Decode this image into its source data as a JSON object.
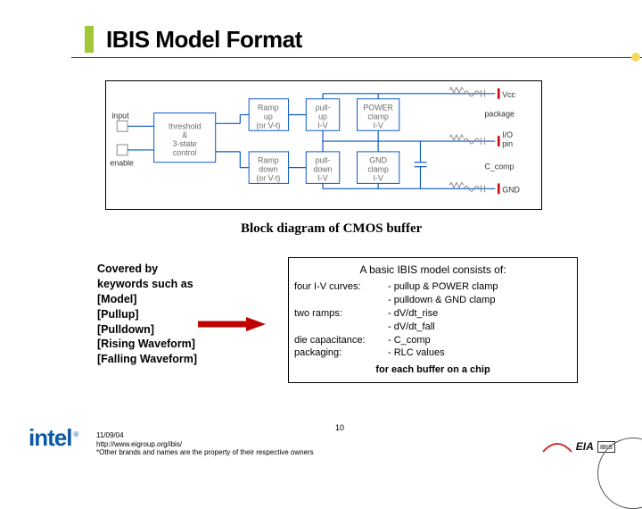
{
  "title": "IBIS Model Format",
  "diagram": {
    "input": "input",
    "enable": "enable",
    "threshold": "threshold & 3-state control",
    "rampup": "Ramp up (or V-t)",
    "rampdown": "Ramp down (or V-t)",
    "pullup": "pull-up I-V",
    "pulldown": "pull-down I-V",
    "powerclamp": "POWER clamp I-V",
    "gndclamp": "GND clamp I-V",
    "package": "package",
    "iopin": "I/O pin",
    "ccomp": "C_comp",
    "vcc": "Vcc",
    "gnd": "GND",
    "caption": "Block diagram of CMOS buffer"
  },
  "left": {
    "l1": "Covered by",
    "l2": "keywords such as",
    "l3": "[Model]",
    "l4": "[Pullup]",
    "l5": "[Pulldown]",
    "l6": "[Rising Waveform]",
    "l7": "[Falling Waveform]"
  },
  "box": {
    "title": "A basic IBIS model consists of:",
    "r1l": "four I-V curves:",
    "r1v1": "- pullup & POWER clamp",
    "r1v2": "- pulldown & GND clamp",
    "r2l": "two ramps:",
    "r2v1": "- dV/dt_rise",
    "r2v2": "- dV/dt_fall",
    "r3l": "die capacitance:",
    "r3v": "- C_comp",
    "r4l": "packaging:",
    "r4v": "- RLC values",
    "footer": "for each buffer on a chip"
  },
  "footer": {
    "date": "11/09/04",
    "url": "http://www.eigroup.org/ibis/",
    "disclaimer": "*Other brands and names are the property of their respective owners",
    "slidenum": "10",
    "intel": "intel",
    "eia": "EIA",
    "ibis": "IBIS"
  },
  "chart_data": {
    "type": "diagram",
    "title": "Block diagram of CMOS buffer",
    "inputs": [
      "input",
      "enable"
    ],
    "control_block": "threshold & 3-state control",
    "driver_blocks": [
      "Ramp up (or V-t)",
      "Ramp down (or V-t)"
    ],
    "iv_blocks": [
      "pull-up I-V",
      "pull-down I-V",
      "POWER clamp I-V",
      "GND clamp I-V"
    ],
    "rails": [
      "Vcc",
      "GND"
    ],
    "package": "package (RLC)",
    "die_cap": "C_comp",
    "output": "I/O pin",
    "ibis_model_contents": {
      "iv_curves": [
        "pullup",
        "POWER clamp",
        "pulldown",
        "GND clamp"
      ],
      "ramps": [
        "dV/dt_rise",
        "dV/dt_fall"
      ],
      "die_capacitance": "C_comp",
      "packaging": "RLC values"
    }
  }
}
